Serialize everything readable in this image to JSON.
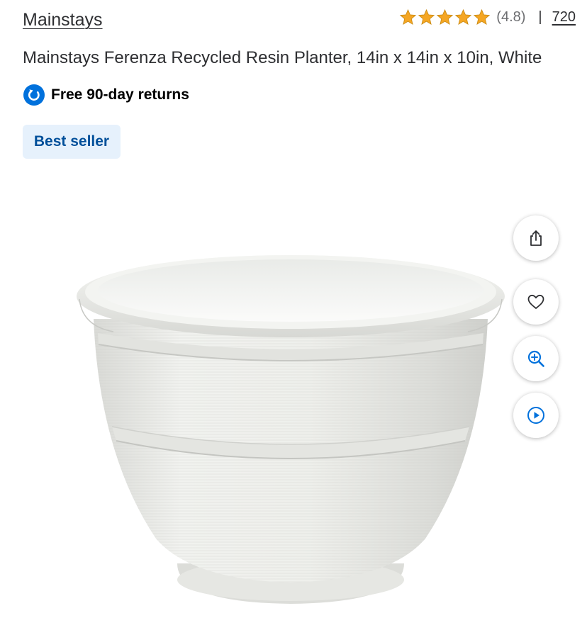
{
  "header": {
    "brand": "Mainstays",
    "rating": {
      "stars": 5,
      "average_text": "(4.8)",
      "separator": "|",
      "count": "720",
      "star_color": "#f5a623"
    }
  },
  "product": {
    "title": "Mainstays Ferenza Recycled Resin Planter, 14in x 14in x 10in, White",
    "returns_text": "Free 90-day returns",
    "badge": "Best seller",
    "image_alt": "White recycled resin planter"
  },
  "actions": [
    {
      "name": "share",
      "icon": "share-icon"
    },
    {
      "name": "favorite",
      "icon": "heart-icon"
    },
    {
      "name": "zoom",
      "icon": "zoom-in-icon"
    },
    {
      "name": "video",
      "icon": "play-icon"
    }
  ],
  "colors": {
    "accent": "#0071dc",
    "badge_bg": "#e6f1fc",
    "badge_text": "#004f9a",
    "muted": "#6d6e71"
  }
}
